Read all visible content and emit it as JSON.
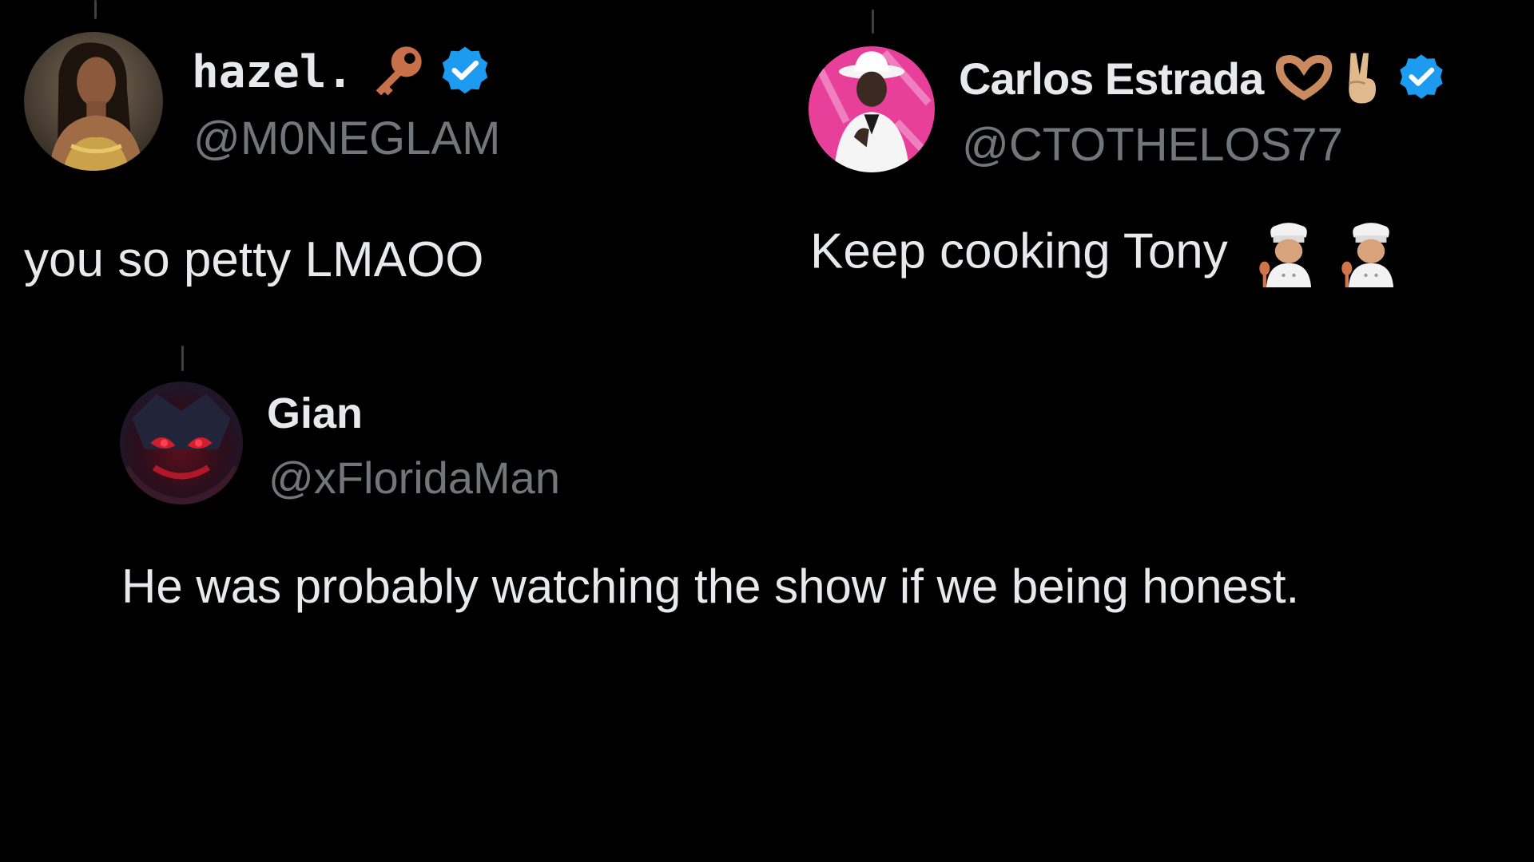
{
  "colors": {
    "background": "#000000",
    "primary_text": "#e7e9ea",
    "secondary_text": "#71767b",
    "verified_badge": "#1d9bf0",
    "thread_line": "#3e4144"
  },
  "tweets": [
    {
      "display_name": "hazel.",
      "name_emoji": "key-emoji",
      "verified": true,
      "handle": "@M0NEGLAM",
      "text": "you so petty LMAOO",
      "avatar": "avatar-hazel"
    },
    {
      "display_name": "Carlos Estrada",
      "name_emojis": [
        "heart-hands-emoji",
        "victory-hand-emoji"
      ],
      "verified": true,
      "handle": "@CTOTHELOS77",
      "text": "Keep cooking Tony",
      "text_emojis": [
        "cook-emoji",
        "cook-emoji"
      ],
      "avatar": "avatar-carlos"
    },
    {
      "display_name": "Gian",
      "verified": false,
      "handle": "@xFloridaMan",
      "text": "He was probably watching the show if we being honest.",
      "avatar": "avatar-gian"
    }
  ]
}
